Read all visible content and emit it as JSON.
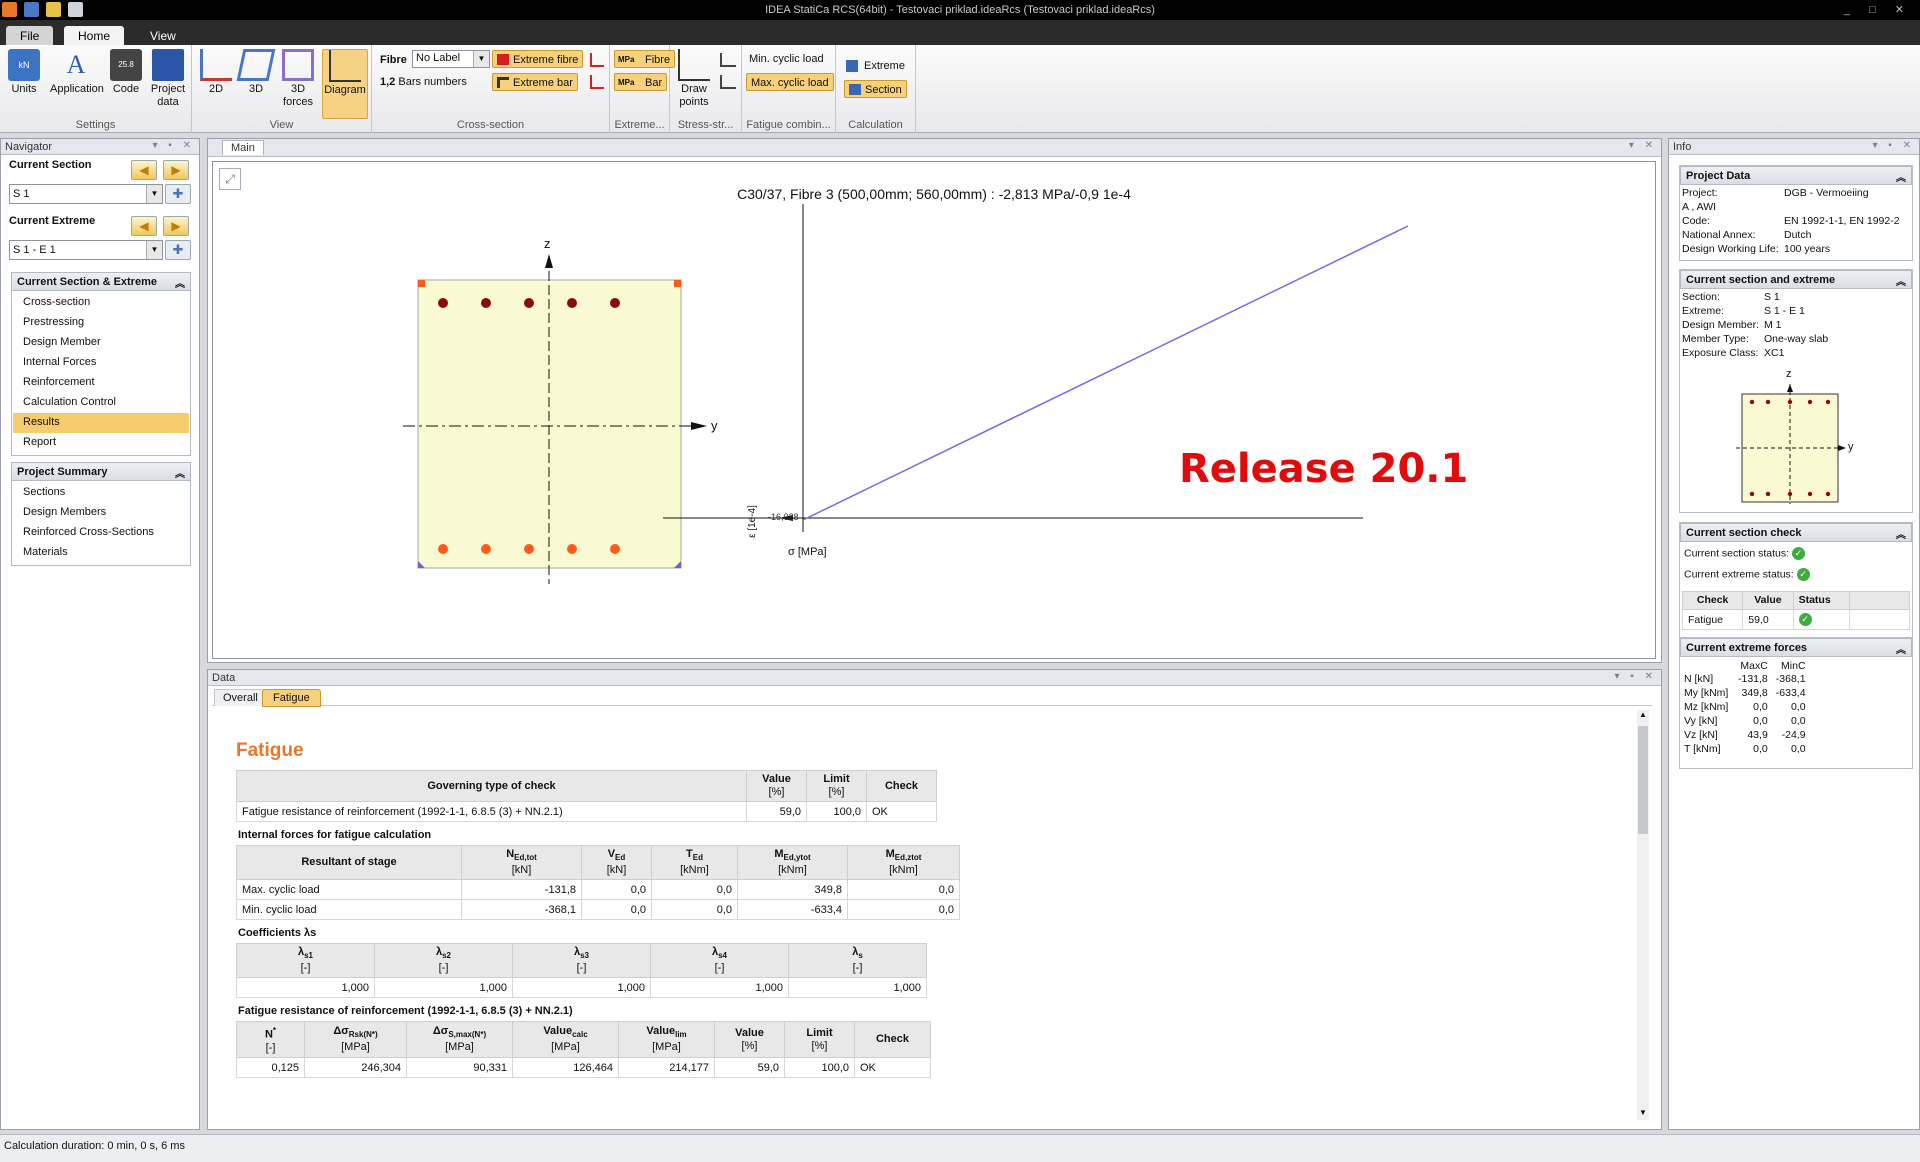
{
  "titlebar": {
    "title": "IDEA StatiCa RCS(64bit) - Testovaci priklad.ideaRcs (Testovaci priklad.ideaRcs)"
  },
  "ribbon_tabs": {
    "file": "File",
    "home": "Home",
    "view": "View"
  },
  "ribbon": {
    "settings": {
      "label": "Settings",
      "units": "Units",
      "application": "Application",
      "code": "Code",
      "project_data_1": "Project",
      "project_data_2": "data"
    },
    "view": {
      "label": "View",
      "b2d": "2D",
      "b3d": "3D",
      "forces_1": "3D",
      "forces_2": "forces",
      "diagram": "Diagram"
    },
    "cross_section": {
      "label": "Cross-section",
      "fibre_label": "Fibre",
      "fibre_value": "No Label",
      "bars_numbers": "Bars numbers",
      "extreme_fibre": "Extreme fibre",
      "extreme_bar": "Extreme bar"
    },
    "extreme": {
      "label": "Extreme...",
      "fibre": "Fibre",
      "bar": "Bar"
    },
    "stress": {
      "label": "Stress-str...",
      "draw_points_1": "Draw",
      "draw_points_2": "points"
    },
    "fatigue": {
      "label": "Fatigue combin...",
      "min": "Min. cyclic load",
      "max": "Max. cyclic load"
    },
    "calculation": {
      "label": "Calculation",
      "extreme": "Extreme",
      "section": "Section"
    }
  },
  "navigator": {
    "title": "Navigator",
    "current_section_label": "Current Section",
    "current_section_value": "S 1",
    "current_extreme_label": "Current Extreme",
    "current_extreme_value": "S 1 - E 1",
    "group1_title": "Current Section & Extreme",
    "group1_items": [
      "Cross-section",
      "Prestressing",
      "Design Member",
      "Internal Forces",
      "Reinforcement",
      "Calculation Control",
      "Results",
      "Report"
    ],
    "group2_title": "Project Summary",
    "group2_items": [
      "Sections",
      "Design Members",
      "Reinforced Cross-Sections",
      "Materials"
    ]
  },
  "main": {
    "tab": "Main",
    "diagram_title": "C30/37, Fibre 3 (500,00mm; 560,00mm) : -2,813 MPa/-0,9 1e-4",
    "axis_z": "z",
    "axis_y": "y",
    "eps_label": "ε [1e-4]",
    "sigma_label": "σ [MPa]",
    "release": "Release 20.1",
    "origin_label": "-16,028"
  },
  "data": {
    "title": "Data",
    "tabs": [
      "Overall",
      "Fatigue"
    ],
    "heading": "Fatigue",
    "t1": {
      "headers": [
        "Governing type of check",
        "Value",
        "Limit",
        "Check"
      ],
      "units": [
        "",
        "[%]",
        "[%]",
        ""
      ],
      "rows": [
        [
          "Fatigue resistance of reinforcement (1992-1-1, 6.8.5 (3) + NN.2.1)",
          "59,0",
          "100,0",
          "OK"
        ]
      ]
    },
    "t2_title": "Internal forces for fatigue calculation",
    "t2": {
      "headers": [
        "Resultant of stage",
        "N",
        "V",
        "T",
        "M",
        "M"
      ],
      "subs": [
        "",
        "Ed,tot",
        "Ed",
        "Ed",
        "Ed,ytot",
        "Ed,ztot"
      ],
      "units": [
        "",
        "[kN]",
        "[kN]",
        "[kNm]",
        "[kNm]",
        "[kNm]"
      ],
      "rows": [
        [
          "Max. cyclic load",
          "-131,8",
          "0,0",
          "0,0",
          "349,8",
          "0,0"
        ],
        [
          "Min. cyclic load",
          "-368,1",
          "0,0",
          "0,0",
          "-633,4",
          "0,0"
        ]
      ]
    },
    "t3_title": "Coefficients λs",
    "t3": {
      "headers": [
        "λ",
        "λ",
        "λ",
        "λ",
        "λ"
      ],
      "subs": [
        "s1",
        "s2",
        "s3",
        "s4",
        "s"
      ],
      "units": [
        "[-]",
        "[-]",
        "[-]",
        "[-]",
        "[-]"
      ],
      "rows": [
        [
          "1,000",
          "1,000",
          "1,000",
          "1,000",
          "1,000"
        ]
      ]
    },
    "t4_title": "Fatigue resistance of reinforcement (1992-1-1, 6.8.5 (3) + NN.2.1)",
    "t4": {
      "headers": [
        "N",
        "Δσ",
        "Δσ",
        "Value",
        "Value",
        "Value",
        "Limit",
        "Check"
      ],
      "subs": [
        "*",
        "Rsk(N*)",
        "S,max(N*)",
        "calc",
        "lim",
        "",
        "",
        ""
      ],
      "units": [
        "[-]",
        "[MPa]",
        "[MPa]",
        "[MPa]",
        "[MPa]",
        "[%]",
        "[%]",
        ""
      ],
      "rows": [
        [
          "0,125",
          "246,304",
          "90,331",
          "126,464",
          "214,177",
          "59,0",
          "100,0",
          "OK"
        ]
      ]
    }
  },
  "info": {
    "title": "Info",
    "project_data_title": "Project Data",
    "project": [
      [
        "Project:",
        "DGB - Vermoeiing"
      ],
      [
        "A , AWI",
        ""
      ],
      [
        "Code:",
        "EN 1992-1-1, EN 1992-2"
      ],
      [
        "National Annex:",
        "Dutch"
      ],
      [
        "Design Working Life:",
        "100 years"
      ]
    ],
    "current_title": "Current section and extreme",
    "current": [
      [
        "Section:",
        "S 1"
      ],
      [
        "Extreme:",
        "S 1 - E 1"
      ],
      [
        "Design Member:",
        "M 1"
      ],
      [
        "Member Type:",
        "One-way slab"
      ],
      [
        "Exposure Class:",
        "XC1"
      ]
    ],
    "check_title": "Current section check",
    "section_status": "Current section status:",
    "extreme_status": "Current extreme status:",
    "check_headers": [
      "Check",
      "Value",
      "Status"
    ],
    "check_row": [
      "Fatigue",
      "59,0"
    ],
    "forces_title": "Current extreme forces",
    "forces_cols": [
      "MaxC",
      "MinC"
    ],
    "forces": [
      [
        "N [kN]",
        "-131,8",
        "-368,1"
      ],
      [
        "My [kNm]",
        "349,8",
        "-633,4"
      ],
      [
        "Mz [kNm]",
        "0,0",
        "0,0"
      ],
      [
        "Vy [kN]",
        "0,0",
        "0,0"
      ],
      [
        "Vz [kN]",
        "43,9",
        "-24,9"
      ],
      [
        "T [kNm]",
        "0,0",
        "0,0"
      ]
    ]
  },
  "status": "Calculation duration: 0 min, 0 s, 6 ms"
}
